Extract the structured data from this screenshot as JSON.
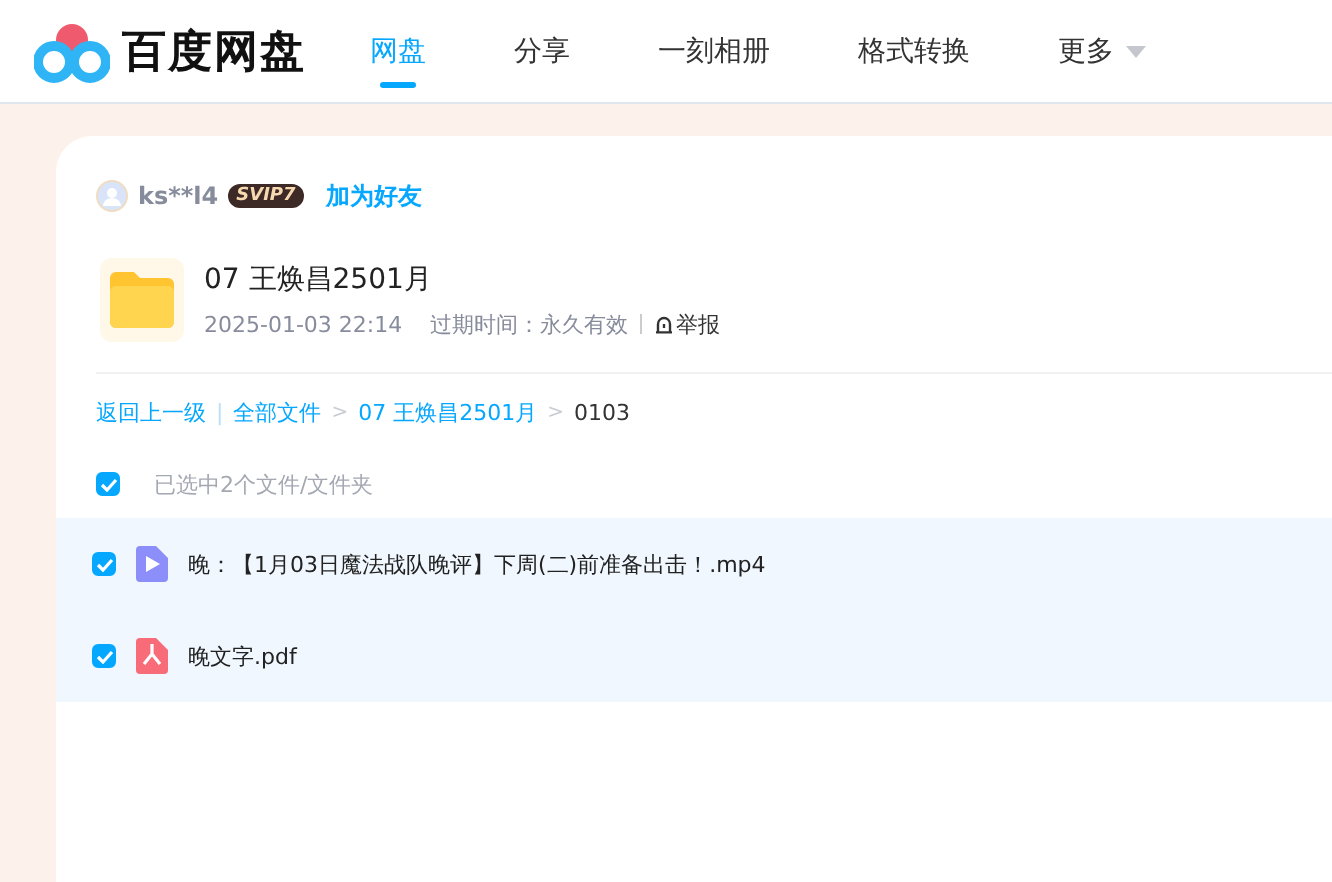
{
  "header": {
    "logo_text": "百度网盘",
    "nav": [
      {
        "label": "网盘",
        "selected": true
      },
      {
        "label": "分享",
        "selected": false
      },
      {
        "label": "一刻相册",
        "selected": false
      },
      {
        "label": "格式转换",
        "selected": false
      },
      {
        "label": "更多",
        "selected": false,
        "dropdown": true
      }
    ]
  },
  "sharer": {
    "name": "ks**l4",
    "badge": "SVIP7",
    "add_friend": "加为好友"
  },
  "share": {
    "title": "07 王焕昌2501月",
    "date": "2025-01-03 22:14",
    "expiry": "过期时间：永久有效",
    "report": "举报"
  },
  "breadcrumb": {
    "back": "返回上一级",
    "divider": "|",
    "items": [
      {
        "label": "全部文件",
        "kind": "link"
      },
      {
        "label": ">",
        "kind": "sep"
      },
      {
        "label": "07 王焕昌2501月",
        "kind": "link"
      },
      {
        "label": ">",
        "kind": "sep"
      },
      {
        "label": "0103",
        "kind": "current"
      }
    ]
  },
  "select_all": {
    "checked": true,
    "label": "已选中2个文件/文件夹"
  },
  "files": [
    {
      "name": "晚：【1月03日魔法战队晚评】下周(二)前准备出击！.mp4",
      "kind": "video",
      "checked": true
    },
    {
      "name": "晚文字.pdf",
      "kind": "pdf",
      "checked": true
    }
  ]
}
